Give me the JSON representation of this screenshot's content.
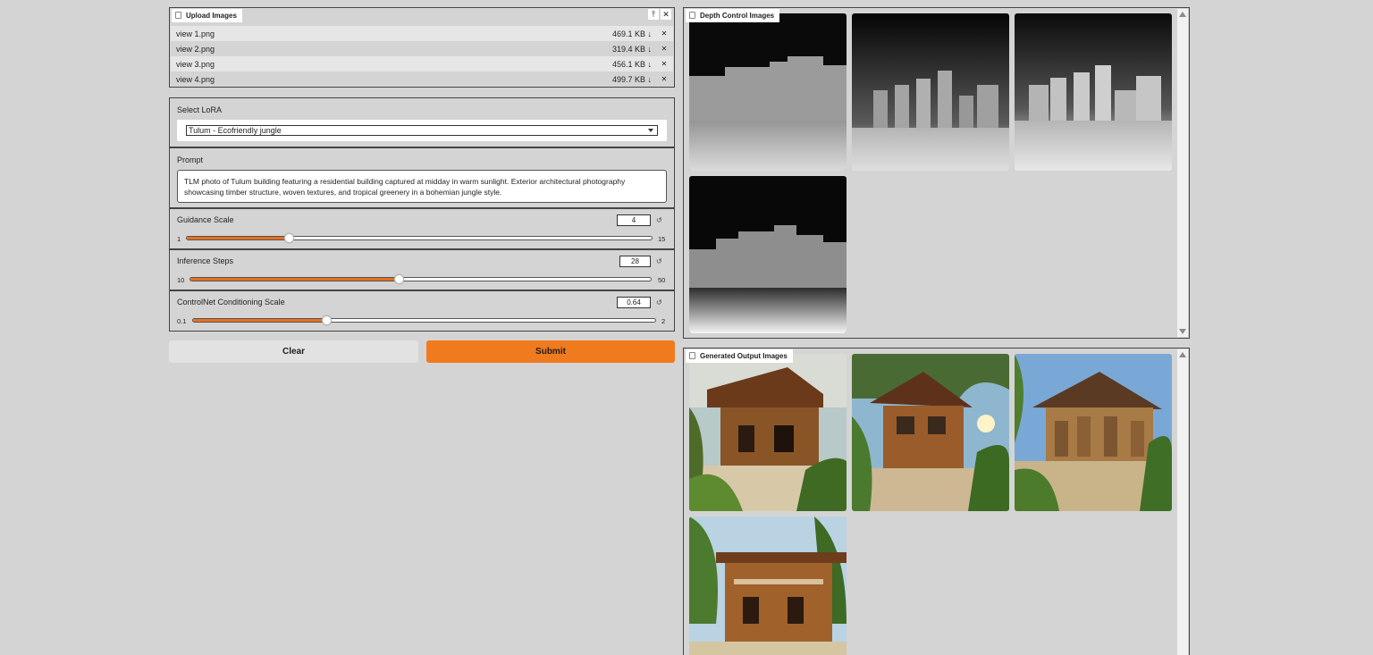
{
  "upload": {
    "label": "Upload Images",
    "files": [
      {
        "name": "view 1.png",
        "size": "469.1 KB ↓"
      },
      {
        "name": "view 2.png",
        "size": "319.4 KB ↓"
      },
      {
        "name": "view 3.png",
        "size": "456.1 KB ↓"
      },
      {
        "name": "view 4.png",
        "size": "499.7 KB ↓"
      }
    ]
  },
  "lora": {
    "label": "Select LoRA",
    "value": "Tulum - Ecofriendly jungle"
  },
  "prompt": {
    "label": "Prompt",
    "value": "TLM photo of Tulum building featuring a residential building captured at midday in warm sunlight. Exterior architectural photography showcasing timber structure, woven textures, and tropical greenery in a bohemian jungle style."
  },
  "guidance": {
    "label": "Guidance Scale",
    "value": "4",
    "min": "1",
    "max": "15"
  },
  "steps": {
    "label": "Inference Steps",
    "value": "28",
    "min": "10",
    "max": "50"
  },
  "controlnet": {
    "label": "ControlNet Conditioning Scale",
    "value": "0.64",
    "min": "0.1",
    "max": "2"
  },
  "buttons": {
    "clear": "Clear",
    "submit": "Submit"
  },
  "depth_gallery": {
    "label": "Depth Control Images"
  },
  "output_gallery": {
    "label": "Generated Output Images"
  },
  "colors": {
    "accent": "#f07a1e",
    "background": "#d4d4d4"
  }
}
